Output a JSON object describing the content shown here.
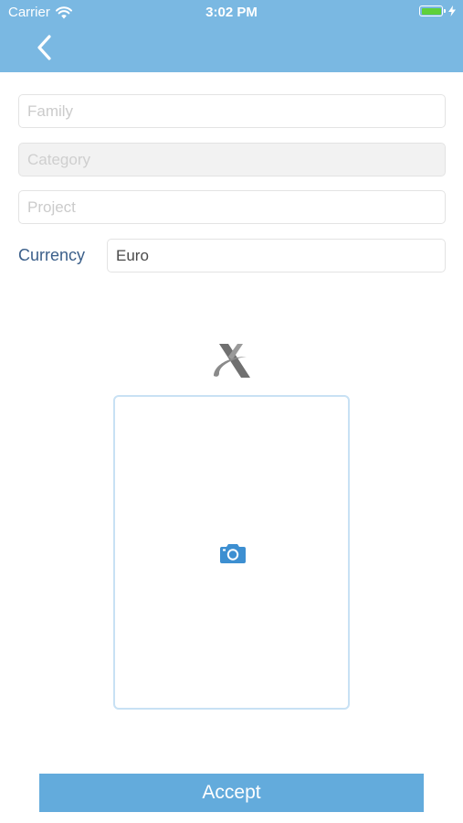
{
  "status_bar": {
    "carrier": "Carrier",
    "time": "3:02 PM",
    "battery_level": 1.0,
    "battery_color": "#5fd03a",
    "charging": true
  },
  "header": {
    "back_icon": "chevron-left-icon",
    "color": "#7ab8e2"
  },
  "form": {
    "family": {
      "placeholder": "Family",
      "value": ""
    },
    "category": {
      "placeholder": "Category",
      "value": "",
      "disabled": true
    },
    "project": {
      "placeholder": "Project",
      "value": ""
    },
    "currency": {
      "label": "Currency",
      "value": "Euro"
    }
  },
  "logo_icon": "brand-logo-icon",
  "photo_box": {
    "icon": "camera-icon",
    "accent": "#3d8fd1"
  },
  "accept_button": {
    "label": "Accept",
    "color": "#63abdc"
  }
}
